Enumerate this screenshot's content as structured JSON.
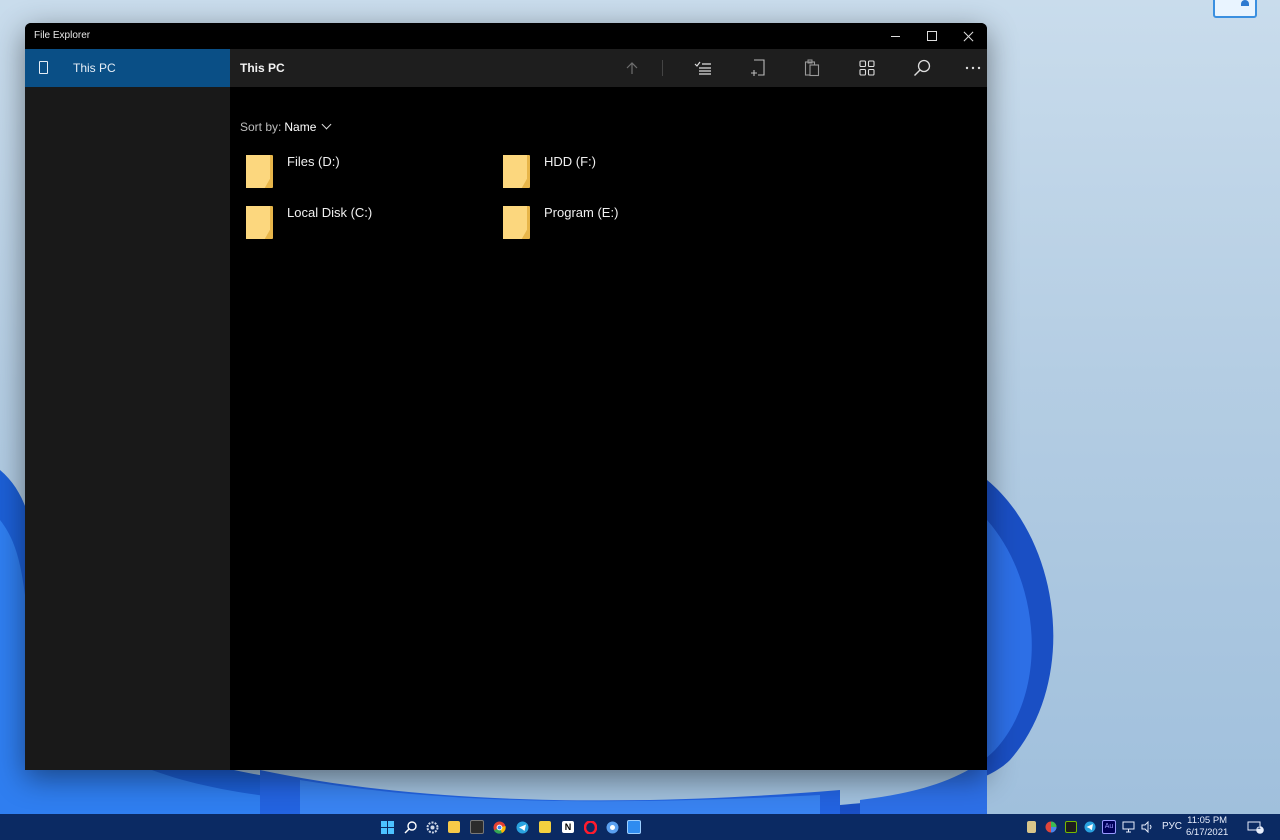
{
  "window": {
    "title": "File Explorer"
  },
  "sidebar": {
    "items": [
      {
        "label": "This PC",
        "icon": "tablet-pc-icon",
        "selected": true
      }
    ]
  },
  "toolbar": {
    "heading": "This PC",
    "buttons": [
      "up-arrow-icon",
      "select-list-icon",
      "new-item-icon",
      "paste-icon",
      "grid-view-icon",
      "search-icon",
      "more-icon"
    ]
  },
  "sort": {
    "label": "Sort by:",
    "value": "Name"
  },
  "drives": [
    {
      "name": "Files (D:)"
    },
    {
      "name": "HDD (F:)"
    },
    {
      "name": "Local Disk (C:)"
    },
    {
      "name": "Program (E:)"
    }
  ],
  "taskbar": {
    "pinned": [
      "start-icon",
      "search-icon",
      "settings-icon",
      "file-explorer-icon",
      "terminal-icon",
      "chrome-icon",
      "telegram-icon",
      "app-icon",
      "notion-icon",
      "opera-icon",
      "chrome-alt-icon",
      "files-app-icon"
    ],
    "tray": {
      "language": "РУС",
      "time": "11:05 PM",
      "date": "6/17/2021",
      "notification_count": "1"
    }
  },
  "colors": {
    "selected_nav": "#0a4f86",
    "folder": "#fcd77e",
    "taskbar": "#0b2a63"
  }
}
